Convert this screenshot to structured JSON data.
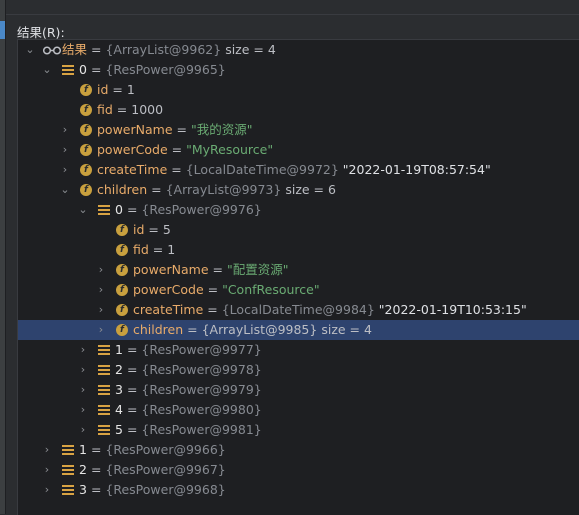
{
  "header": {
    "label": "结果(R):"
  },
  "tree": {
    "root": {
      "name": "结果",
      "ref": "{ArrayList@9962}",
      "extra": "size = 4"
    },
    "e0": {
      "name": "0",
      "ref": "{ResPower@9965}"
    },
    "e0_id": {
      "name": "id",
      "value": "1"
    },
    "e0_fid": {
      "name": "fid",
      "value": "1000"
    },
    "e0_powerName": {
      "name": "powerName",
      "value": "\"我的资源\""
    },
    "e0_powerCode": {
      "name": "powerCode",
      "value": "\"MyResource\""
    },
    "e0_createTime": {
      "name": "createTime",
      "ref": "{LocalDateTime@9972}",
      "value": "\"2022-01-19T08:57:54\""
    },
    "e0_children": {
      "name": "children",
      "ref": "{ArrayList@9973}",
      "extra": "size = 6"
    },
    "c0": {
      "name": "0",
      "ref": "{ResPower@9976}"
    },
    "c0_id": {
      "name": "id",
      "value": "5"
    },
    "c0_fid": {
      "name": "fid",
      "value": "1"
    },
    "c0_powerName": {
      "name": "powerName",
      "value": "\"配置资源\""
    },
    "c0_powerCode": {
      "name": "powerCode",
      "value": "\"ConfResource\""
    },
    "c0_createTime": {
      "name": "createTime",
      "ref": "{LocalDateTime@9984}",
      "value": "\"2022-01-19T10:53:15\""
    },
    "c0_children": {
      "name": "children",
      "ref": "{ArrayList@9985}",
      "extra": "size = 4"
    },
    "c1": {
      "name": "1",
      "ref": "{ResPower@9977}"
    },
    "c2": {
      "name": "2",
      "ref": "{ResPower@9978}"
    },
    "c3": {
      "name": "3",
      "ref": "{ResPower@9979}"
    },
    "c4": {
      "name": "4",
      "ref": "{ResPower@9980}"
    },
    "c5": {
      "name": "5",
      "ref": "{ResPower@9981}"
    },
    "e1": {
      "name": "1",
      "ref": "{ResPower@9966}"
    },
    "e2": {
      "name": "2",
      "ref": "{ResPower@9967}"
    },
    "e3": {
      "name": "3",
      "ref": "{ResPower@9968}"
    }
  },
  "colors": {
    "background": "#1e1f22",
    "selection": "#2e436e",
    "field_icon": "#c9a03e",
    "string_value": "#6aab73",
    "reference": "#868a91"
  },
  "icons": {
    "expanded": "chevron-down-icon",
    "collapsed": "chevron-right-icon",
    "field": "field-icon",
    "object": "object-icon",
    "watch": "glasses-icon"
  }
}
